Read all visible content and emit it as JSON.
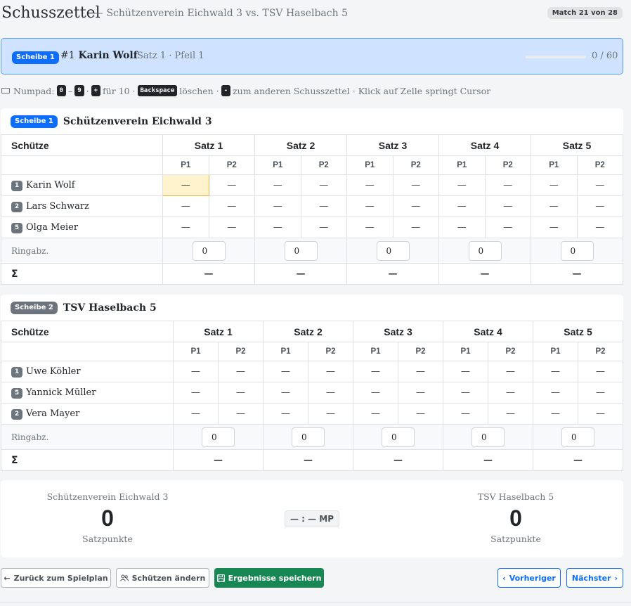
{
  "header": {
    "title": "Schusszettel",
    "subtitle": "— Schützenverein Eichwald 3 vs. TSV Haselbach 5",
    "match_badge": "Match 21 von 28"
  },
  "active": {
    "scheibe": "Scheibe 1",
    "number": "#1",
    "name": "Karin Wolf",
    "position": "Satz 1 · Pfeil 1",
    "progress_count": "0 / 60",
    "progress_fraction": 0
  },
  "hint": {
    "prefix": "Numpad:",
    "k0": "0",
    "dash": "–",
    "k9": "9",
    "sep": "·",
    "kplus": "+",
    "for10": "für 10 ·",
    "kback": "Backspace",
    "delete": "löschen ·",
    "kminus": "-",
    "rest": "zum anderen Schusszettel · Klick auf Zelle springt Cursor"
  },
  "labels": {
    "shooter": "Schütze",
    "sets": [
      "Satz 1",
      "Satz 2",
      "Satz 3",
      "Satz 4",
      "Satz 5"
    ],
    "p1": "P1",
    "p2": "P2",
    "ring": "Ringabz.",
    "sum": "Σ",
    "empty": "—"
  },
  "teams": [
    {
      "scheibe": "Scheibe 1",
      "name": "Schützenverein Eichwald 3",
      "shooters": [
        {
          "nr": "1",
          "name": "Karin Wolf"
        },
        {
          "nr": "2",
          "name": "Lars Schwarz"
        },
        {
          "nr": "5",
          "name": "Olga Meier"
        }
      ],
      "ring": [
        "0",
        "0",
        "0",
        "0",
        "0"
      ],
      "sums": [
        "—",
        "—",
        "—",
        "—",
        "—"
      ]
    },
    {
      "scheibe": "Scheibe 2",
      "name": "TSV Haselbach 5",
      "shooters": [
        {
          "nr": "1",
          "name": "Uwe Köhler"
        },
        {
          "nr": "5",
          "name": "Yannick Müller"
        },
        {
          "nr": "2",
          "name": "Vera Mayer"
        }
      ],
      "ring": [
        "0",
        "0",
        "0",
        "0",
        "0"
      ],
      "sums": [
        "—",
        "—",
        "—",
        "—",
        "—"
      ]
    }
  ],
  "result": {
    "home_name": "Schützenverein Eichwald 3",
    "home_points": "0",
    "away_name": "TSV Haselbach 5",
    "away_points": "0",
    "points_label": "Satzpunkte",
    "mp": "— : — MP"
  },
  "buttons": {
    "back": "Zurück zum Spielplan",
    "change": "Schützen ändern",
    "save": "Ergebnisse speichern",
    "prev": "Vorheriger",
    "next": "Nächster"
  },
  "colors": {
    "primary": "#0d6efd",
    "success": "#198754",
    "active_cell": "#fff3cd",
    "banner": "#cfe2ff"
  }
}
